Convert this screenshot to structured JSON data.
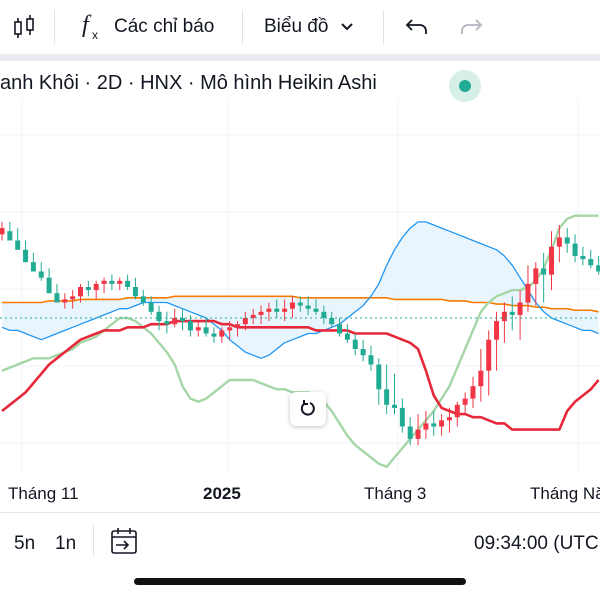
{
  "toolbar": {
    "indicators_label": "Các chỉ báo",
    "chart_label": "Biểu đồ"
  },
  "legend": {
    "text": "anh Khôi · 2D · HNX · Mô hình Heikin Ashi",
    "status_color": "#22ab94"
  },
  "colors": {
    "up": "#22ab94",
    "down": "#f23645",
    "tenkan": "#2196f3",
    "kijun": "#e5283a",
    "chikou": "#a5d6a7",
    "ma": "#f57c00",
    "cloud": "#e3f2fd"
  },
  "chart_data": {
    "type": "candlestick",
    "style": "Heikin Ashi",
    "x_labels": [
      "Tháng 11",
      "2025",
      "Tháng 3",
      "Tháng Năm"
    ],
    "y_ticks_shown": false,
    "grid": true,
    "candles": [
      {
        "o": 54,
        "h": 50,
        "l": 62,
        "c": 58
      },
      {
        "o": 56,
        "h": 52,
        "l": 62,
        "c": 50
      },
      {
        "o": 50,
        "h": 46,
        "l": 58,
        "c": 44
      },
      {
        "o": 44,
        "h": 38,
        "l": 50,
        "c": 36
      },
      {
        "o": 36,
        "h": 30,
        "l": 42,
        "c": 30
      },
      {
        "o": 30,
        "h": 24,
        "l": 36,
        "c": 26
      },
      {
        "o": 26,
        "h": 18,
        "l": 32,
        "c": 16
      },
      {
        "o": 16,
        "h": 10,
        "l": 22,
        "c": 10
      },
      {
        "o": 10,
        "h": 6,
        "l": 16,
        "c": 12
      },
      {
        "o": 12,
        "h": 6,
        "l": 18,
        "c": 14
      },
      {
        "o": 14,
        "h": 10,
        "l": 22,
        "c": 20
      },
      {
        "o": 20,
        "h": 14,
        "l": 24,
        "c": 18
      },
      {
        "o": 18,
        "h": 12,
        "l": 24,
        "c": 22
      },
      {
        "o": 22,
        "h": 16,
        "l": 26,
        "c": 24
      },
      {
        "o": 24,
        "h": 18,
        "l": 28,
        "c": 22
      },
      {
        "o": 22,
        "h": 18,
        "l": 26,
        "c": 24
      },
      {
        "o": 24,
        "h": 18,
        "l": 28,
        "c": 20
      },
      {
        "o": 20,
        "h": 12,
        "l": 26,
        "c": 14
      },
      {
        "o": 14,
        "h": 8,
        "l": 18,
        "c": 10
      },
      {
        "o": 10,
        "h": 2,
        "l": 14,
        "c": 4
      },
      {
        "o": 4,
        "h": -8,
        "l": 8,
        "c": -2
      },
      {
        "o": -2,
        "h": -10,
        "l": 4,
        "c": -4
      },
      {
        "o": -4,
        "h": -6,
        "l": 6,
        "c": 0
      },
      {
        "o": 0,
        "h": -8,
        "l": 6,
        "c": -2
      },
      {
        "o": -2,
        "h": -12,
        "l": 2,
        "c": -8
      },
      {
        "o": -8,
        "h": -12,
        "l": -2,
        "c": -6
      },
      {
        "o": -6,
        "h": -12,
        "l": 0,
        "c": -10
      },
      {
        "o": -10,
        "h": -16,
        "l": -6,
        "c": -12
      },
      {
        "o": -12,
        "h": -16,
        "l": -6,
        "c": -8
      },
      {
        "o": -8,
        "h": -14,
        "l": -2,
        "c": -6
      },
      {
        "o": -6,
        "h": -12,
        "l": -2,
        "c": -4
      },
      {
        "o": -4,
        "h": -8,
        "l": 4,
        "c": 0
      },
      {
        "o": 0,
        "h": -4,
        "l": 6,
        "c": 2
      },
      {
        "o": 2,
        "h": -4,
        "l": 8,
        "c": 4
      },
      {
        "o": 4,
        "h": -2,
        "l": 10,
        "c": 6
      },
      {
        "o": 6,
        "h": 0,
        "l": 12,
        "c": 4
      },
      {
        "o": 4,
        "h": -2,
        "l": 12,
        "c": 6
      },
      {
        "o": 6,
        "h": 0,
        "l": 14,
        "c": 10
      },
      {
        "o": 10,
        "h": 4,
        "l": 14,
        "c": 8
      },
      {
        "o": 8,
        "h": 2,
        "l": 14,
        "c": 6
      },
      {
        "o": 6,
        "h": 2,
        "l": 12,
        "c": 4
      },
      {
        "o": 4,
        "h": -4,
        "l": 8,
        "c": 0
      },
      {
        "o": 0,
        "h": -6,
        "l": 4,
        "c": -4
      },
      {
        "o": -4,
        "h": -12,
        "l": 0,
        "c": -10
      },
      {
        "o": -10,
        "h": -16,
        "l": -4,
        "c": -14
      },
      {
        "o": -14,
        "h": -24,
        "l": -10,
        "c": -20
      },
      {
        "o": -20,
        "h": -28,
        "l": -14,
        "c": -24
      },
      {
        "o": -24,
        "h": -34,
        "l": -18,
        "c": -30
      },
      {
        "o": -30,
        "h": -56,
        "l": -26,
        "c": -46
      },
      {
        "o": -46,
        "h": -62,
        "l": -30,
        "c": -56
      },
      {
        "o": -56,
        "h": -62,
        "l": -36,
        "c": -58
      },
      {
        "o": -58,
        "h": -74,
        "l": -52,
        "c": -70
      },
      {
        "o": -70,
        "h": -82,
        "l": -64,
        "c": -78
      },
      {
        "o": -78,
        "h": -82,
        "l": -62,
        "c": -72
      },
      {
        "o": -72,
        "h": -78,
        "l": -60,
        "c": -68
      },
      {
        "o": -68,
        "h": -76,
        "l": -60,
        "c": -70
      },
      {
        "o": -70,
        "h": -76,
        "l": -62,
        "c": -66
      },
      {
        "o": -66,
        "h": -74,
        "l": -58,
        "c": -64
      },
      {
        "o": -64,
        "h": -70,
        "l": -54,
        "c": -56
      },
      {
        "o": -56,
        "h": -62,
        "l": -48,
        "c": -52
      },
      {
        "o": -52,
        "h": -58,
        "l": -38,
        "c": -44
      },
      {
        "o": -44,
        "h": -54,
        "l": -20,
        "c": -34
      },
      {
        "o": -34,
        "h": -50,
        "l": -8,
        "c": -14
      },
      {
        "o": -14,
        "h": -34,
        "l": 4,
        "c": -2
      },
      {
        "o": -2,
        "h": -16,
        "l": 10,
        "c": 4
      },
      {
        "o": 4,
        "h": -8,
        "l": 14,
        "c": 2
      },
      {
        "o": 2,
        "h": -14,
        "l": 18,
        "c": 10
      },
      {
        "o": 10,
        "h": 4,
        "l": 34,
        "c": 22
      },
      {
        "o": 22,
        "h": 8,
        "l": 36,
        "c": 32
      },
      {
        "o": 32,
        "h": 10,
        "l": 42,
        "c": 28
      },
      {
        "o": 28,
        "h": 18,
        "l": 56,
        "c": 46
      },
      {
        "o": 46,
        "h": 36,
        "l": 60,
        "c": 52
      },
      {
        "o": 52,
        "h": 42,
        "l": 58,
        "c": 48
      },
      {
        "o": 48,
        "h": 36,
        "l": 54,
        "c": 40
      },
      {
        "o": 40,
        "h": 34,
        "l": 46,
        "c": 38
      },
      {
        "o": 38,
        "h": 32,
        "l": 44,
        "c": 34
      },
      {
        "o": 34,
        "h": 28,
        "l": 40,
        "c": 30
      }
    ],
    "tenkan": [
      -6,
      -8,
      -8,
      -10,
      -12,
      -14,
      -12,
      -10,
      -8,
      -6,
      -4,
      -2,
      0,
      2,
      4,
      6,
      6,
      8,
      10,
      10,
      10,
      10,
      8,
      6,
      4,
      2,
      0,
      -4,
      -8,
      -14,
      -18,
      -22,
      -24,
      -26,
      -24,
      -20,
      -16,
      -14,
      -12,
      -10,
      -10,
      -8,
      -6,
      -4,
      0,
      4,
      8,
      14,
      22,
      34,
      44,
      52,
      58,
      62,
      62,
      60,
      58,
      56,
      54,
      52,
      50,
      48,
      46,
      44,
      40,
      34,
      26,
      18,
      10,
      4,
      0,
      -2,
      -4,
      -6,
      -8,
      -8,
      -10
    ],
    "kijun": [
      -60,
      -56,
      -52,
      -48,
      -42,
      -36,
      -30,
      -26,
      -22,
      -18,
      -14,
      -12,
      -10,
      -8,
      -8,
      -8,
      -6,
      -6,
      -6,
      -4,
      -4,
      -4,
      -2,
      -2,
      -2,
      -2,
      -2,
      -2,
      -4,
      -4,
      -6,
      -6,
      -6,
      -6,
      -6,
      -6,
      -6,
      -6,
      -6,
      -6,
      -8,
      -8,
      -8,
      -8,
      -8,
      -10,
      -10,
      -10,
      -10,
      -10,
      -12,
      -14,
      -16,
      -20,
      -34,
      -50,
      -58,
      -60,
      -62,
      -62,
      -64,
      -64,
      -66,
      -68,
      -68,
      -72,
      -72,
      -72,
      -72,
      -72,
      -72,
      -72,
      -60,
      -54,
      -50,
      -46,
      -40
    ],
    "chikou": [
      -34,
      -32,
      -30,
      -28,
      -26,
      -26,
      -26,
      -24,
      -22,
      -20,
      -16,
      -14,
      -12,
      -8,
      -4,
      0,
      0,
      -2,
      -6,
      -10,
      -16,
      -22,
      -30,
      -44,
      -52,
      -54,
      -52,
      -48,
      -44,
      -40,
      -40,
      -40,
      -40,
      -42,
      -44,
      -46,
      -46,
      -48,
      -48,
      -48,
      -50,
      -54,
      -60,
      -68,
      -76,
      -82,
      -86,
      -90,
      -94,
      -96,
      -90,
      -84,
      -78,
      -72,
      -66,
      -60,
      -52,
      -44,
      -32,
      -20,
      -8,
      4,
      10,
      14,
      16,
      18,
      18,
      20,
      24,
      32,
      44,
      58,
      64,
      66,
      66,
      66,
      66
    ],
    "ma": [
      10,
      10,
      10,
      10,
      10,
      10,
      11,
      11,
      11,
      11,
      12,
      12,
      12,
      12,
      12,
      12,
      13,
      13,
      13,
      13,
      13,
      13,
      14,
      14,
      14,
      14,
      14,
      14,
      14,
      14,
      14,
      14,
      14,
      14,
      14,
      14,
      14,
      14,
      13,
      13,
      13,
      13,
      13,
      13,
      13,
      13,
      13,
      13,
      13,
      13,
      12,
      12,
      12,
      12,
      12,
      12,
      12,
      11,
      11,
      11,
      10,
      10,
      10,
      9,
      9,
      8,
      8,
      8,
      7,
      7,
      6,
      6,
      6,
      5,
      5,
      5,
      4
    ]
  },
  "bottom": {
    "range_5n": "5n",
    "range_1n": "1n",
    "time": "09:34:00 (UTC"
  }
}
